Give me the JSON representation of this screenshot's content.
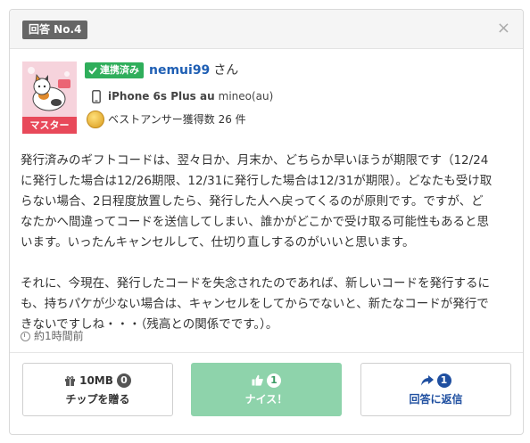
{
  "answer_no": "回答 No.4",
  "close_label": "×",
  "user": {
    "rank_badge": "マスター",
    "linked_label": "連携済み",
    "name": "nemui99",
    "honorific": "さん",
    "device_model": "iPhone 6s Plus au",
    "device_carrier": "mineo(au)",
    "best_answer": "ベストアンサー獲得数 26 件"
  },
  "answer_text": "発行済みのギフトコードは、翌々日か、月末か、どちらか早いほうが期限です（12/24\nに発行した場合は12/26期限、12/31に発行した場合は12/31が期限）。どなたも受け取\nらない場合、2日程度放置したら、発行した人へ戻ってくるのが原則です。ですが、ど\nなたかへ間違ってコードを送信してしまい、誰かがどこかで受け取る可能性もあると思\nいます。いったんキャンセルして、仕切り直しするのがいいと思います。\n\nそれに、今現在、発行したコードを失念されたのであれば、新しいコードを発行するに\nも、持ちパケが少ない場合は、キャンセルをしてからでないと、新たなコードが発行で\nきないですしね・・・（残高との関係でです。）。",
  "time_ago": "約1時間前",
  "buttons": {
    "tip": {
      "amount": "10MB",
      "count": "0",
      "label": "チップを贈る"
    },
    "nice": {
      "count": "1",
      "label": "ナイス！"
    },
    "reply": {
      "count": "1",
      "label": "回答に返信"
    }
  },
  "colors": {
    "linked_green": "#2fae5b",
    "master_red": "#e8495a",
    "nice_green": "#8ed3ab",
    "link_blue": "#1f5fb4"
  }
}
